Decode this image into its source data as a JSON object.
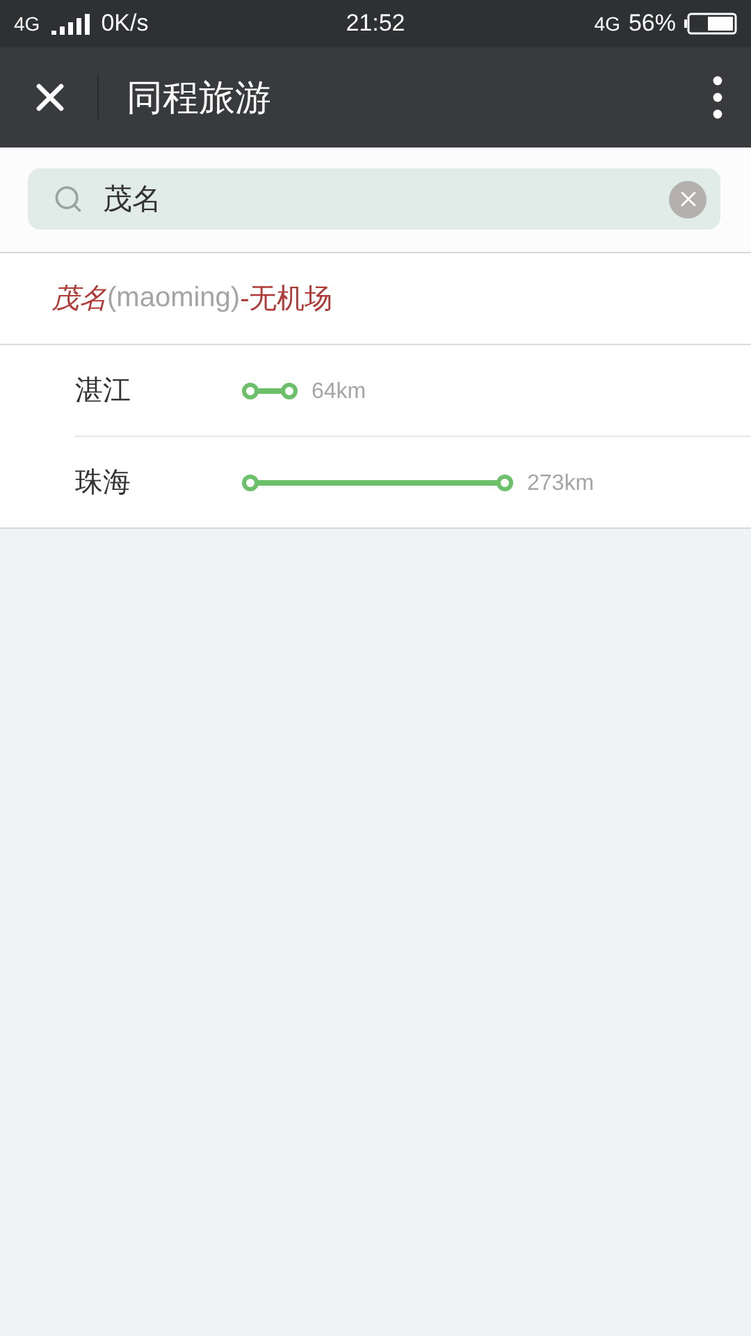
{
  "status_bar": {
    "network": "4G",
    "speed": "0K/s",
    "time": "21:52",
    "network_2": "4G",
    "battery": "56%"
  },
  "app_bar": {
    "title": "同程旅游"
  },
  "search": {
    "value": "茂名"
  },
  "result": {
    "city": "茂名",
    "pinyin": "(maoming)",
    "note": "-无机场"
  },
  "nearby": [
    {
      "name": "湛江",
      "distance": "64km"
    },
    {
      "name": "珠海",
      "distance": "273km"
    }
  ]
}
